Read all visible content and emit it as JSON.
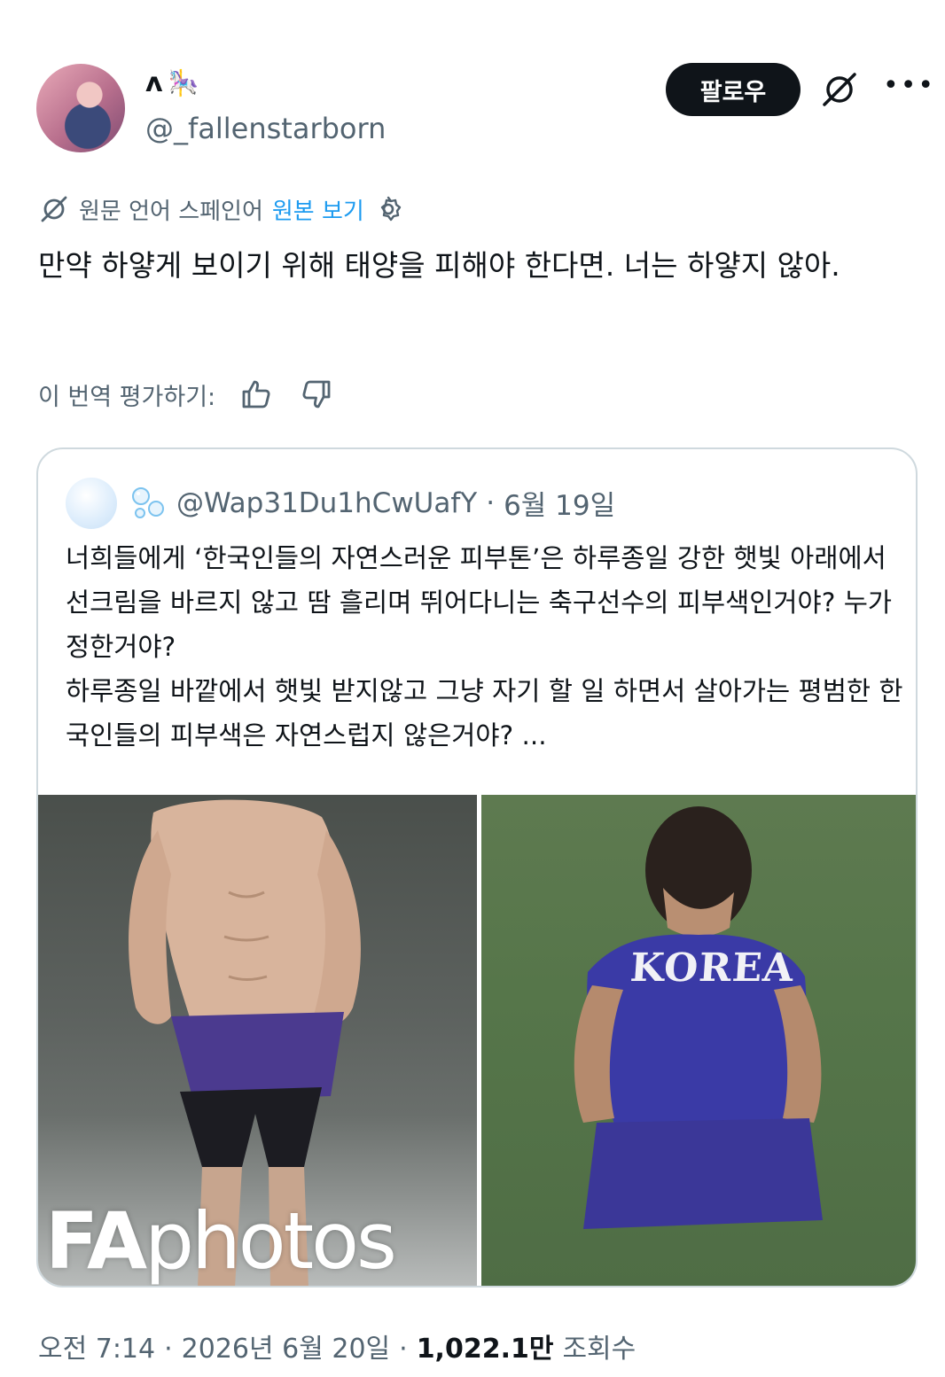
{
  "header": {
    "display_name": "ʌ",
    "display_name_emoji": "🎠",
    "handle": "@_fallenstarborn",
    "follow_label": "팔로우",
    "more_label": "•••"
  },
  "translation": {
    "source_language": "원문 언어 스페인어",
    "show_original": "원본 보기"
  },
  "tweet": {
    "text": "만약 하얗게 보이기 위해 태양을 피해야 한다면. 너는 하얗지 않아."
  },
  "rate": {
    "label": "이 번역 평가하기:"
  },
  "quote": {
    "emoji": "🫧",
    "handle": "@Wap31Du1hCwUafY",
    "separator": "·",
    "date": "6월 19일",
    "text_lines": [
      "너희들에게 ‘한국인들의 자연스러운 피부톤’은 하루종일 강한 햇빛 아래에서 선크림을 바르지 않고 땀 흘리며 뛰어다니는 축구선수의 피부색인거야? 누가 정한거야?",
      "하루종일 바깥에서 햇빛 받지않고 그냥 자기 할 일 하면서 살아가는 평범한 한국인들의 피부색은 자연스럽지 않은거야?  ..."
    ],
    "photo_left_watermark_bold": "FA",
    "photo_left_watermark_rest": "photos",
    "photo_right_jersey": "KOREA"
  },
  "footer": {
    "time": "오전 7:14",
    "sep1": "·",
    "date": "2026년 6월 20일",
    "sep2": "·",
    "views_count": "1,022.1만",
    "views_label": "조회수"
  },
  "colors": {
    "text": "#0f1419",
    "muted": "#536471",
    "link": "#1d9bf0",
    "border": "#cfd9de"
  }
}
